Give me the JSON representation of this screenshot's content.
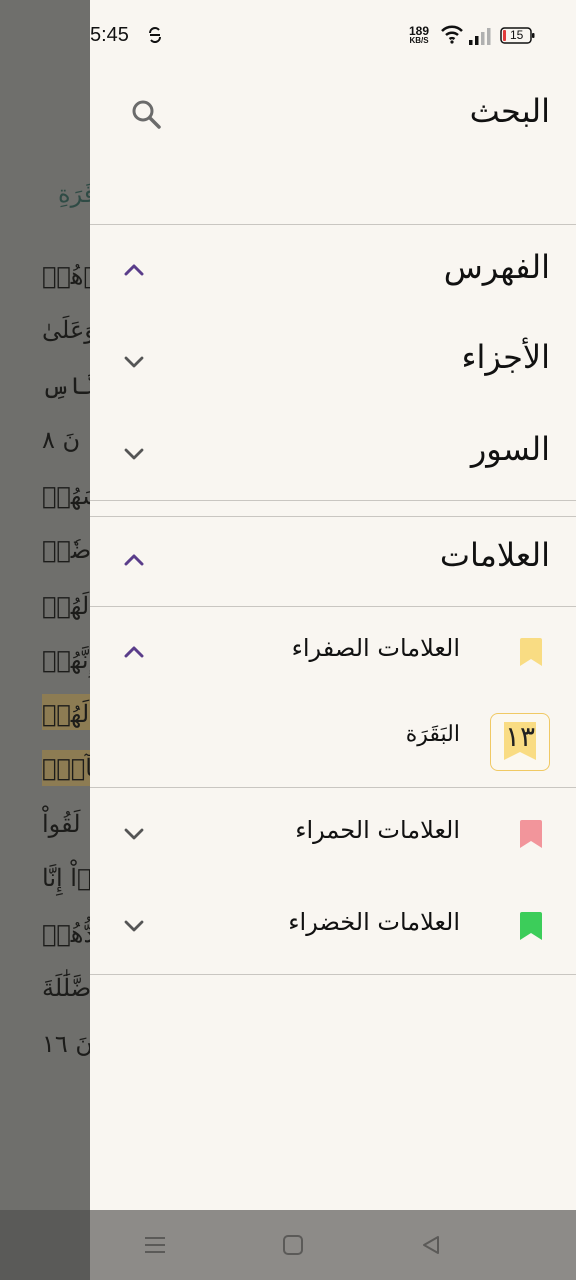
{
  "status_bar": {
    "time": "5:45",
    "speed_value": "189",
    "speed_unit": "KB/S",
    "battery": "15"
  },
  "background": {
    "surah_title": "قَرَةِ",
    "lines": [
      "ذِرۡهُمۡ",
      "وَعَلَىٰ",
      "ٱلنَّاسِ",
      "نَ ٨",
      "سَهُمۡ",
      "مَرَضٗاۖ",
      "لَهُمۡ",
      "إِنَّهُمۡ",
      "لَهُمۡ",
      "سُفَهَآءُۗ",
      "لَقُواْ",
      "وۡاْ إِنَّا",
      "مُدُّهُمۡ",
      "ضَّلَٰلَةَ",
      "نَ ١٦"
    ]
  },
  "drawer": {
    "search_label": "البحث",
    "index_label": "الفهرس",
    "parts_label": "الأجزاء",
    "surahs_label": "السور",
    "bookmarks_label": "العلامات",
    "yellow_label": "العلامات الصفراء",
    "red_label": "العلامات الحمراء",
    "green_label": "العلامات الخضراء",
    "yellow_item": {
      "surah": "البَقَرَة",
      "page_number": "١٣"
    }
  },
  "colors": {
    "accent": "#5a3d8a",
    "yellow": "#f9dc83",
    "red": "#f2959b",
    "green": "#3ccd5a",
    "drawer_bg": "#f9f6f1"
  }
}
